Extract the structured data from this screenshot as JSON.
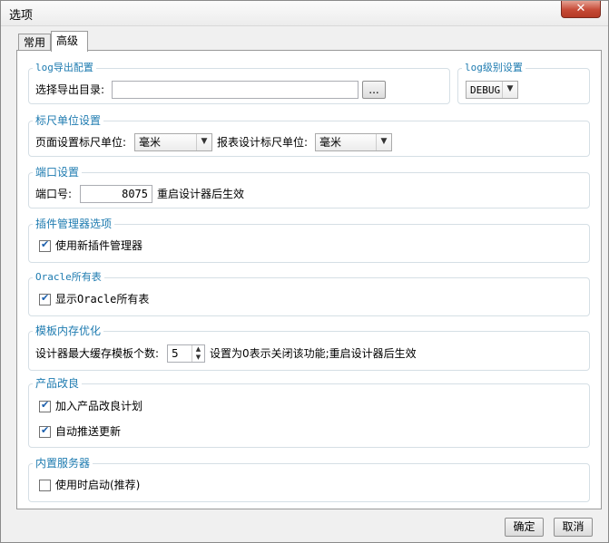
{
  "window": {
    "title": "选项",
    "close_label": "✕"
  },
  "tabs": [
    {
      "label": "常用"
    },
    {
      "label": "高级"
    }
  ],
  "log_export": {
    "title": "log导出配置",
    "dir_label": "选择导出目录:",
    "dir_value": "",
    "browse_label": "..."
  },
  "log_level": {
    "title": "log级别设置",
    "value": "DEBUG"
  },
  "ruler": {
    "title": "标尺单位设置",
    "page_label": "页面设置标尺单位:",
    "page_value": "毫米",
    "report_label": "报表设计标尺单位:",
    "report_value": "毫米"
  },
  "port": {
    "title": "端口设置",
    "label": "端口号:",
    "value": "8075",
    "note": "重启设计器后生效"
  },
  "plugin": {
    "title": "插件管理器选项",
    "checkbox_label": "使用新插件管理器",
    "checked": true
  },
  "oracle": {
    "title": "Oracle所有表",
    "checkbox_label": "显示Oracle所有表",
    "checked": true
  },
  "template_cache": {
    "title": "模板内存优化",
    "label": "设计器最大缓存模板个数:",
    "value": "5",
    "note": "设置为0表示关闭该功能;重启设计器后生效"
  },
  "improve": {
    "title": "产品改良",
    "join_label": "加入产品改良计划",
    "join_checked": true,
    "push_label": "自动推送更新",
    "push_checked": true
  },
  "server": {
    "title": "内置服务器",
    "checkbox_label": "使用时启动(推荐)",
    "checked": false
  },
  "footer": {
    "ok_label": "确定",
    "cancel_label": "取消"
  }
}
